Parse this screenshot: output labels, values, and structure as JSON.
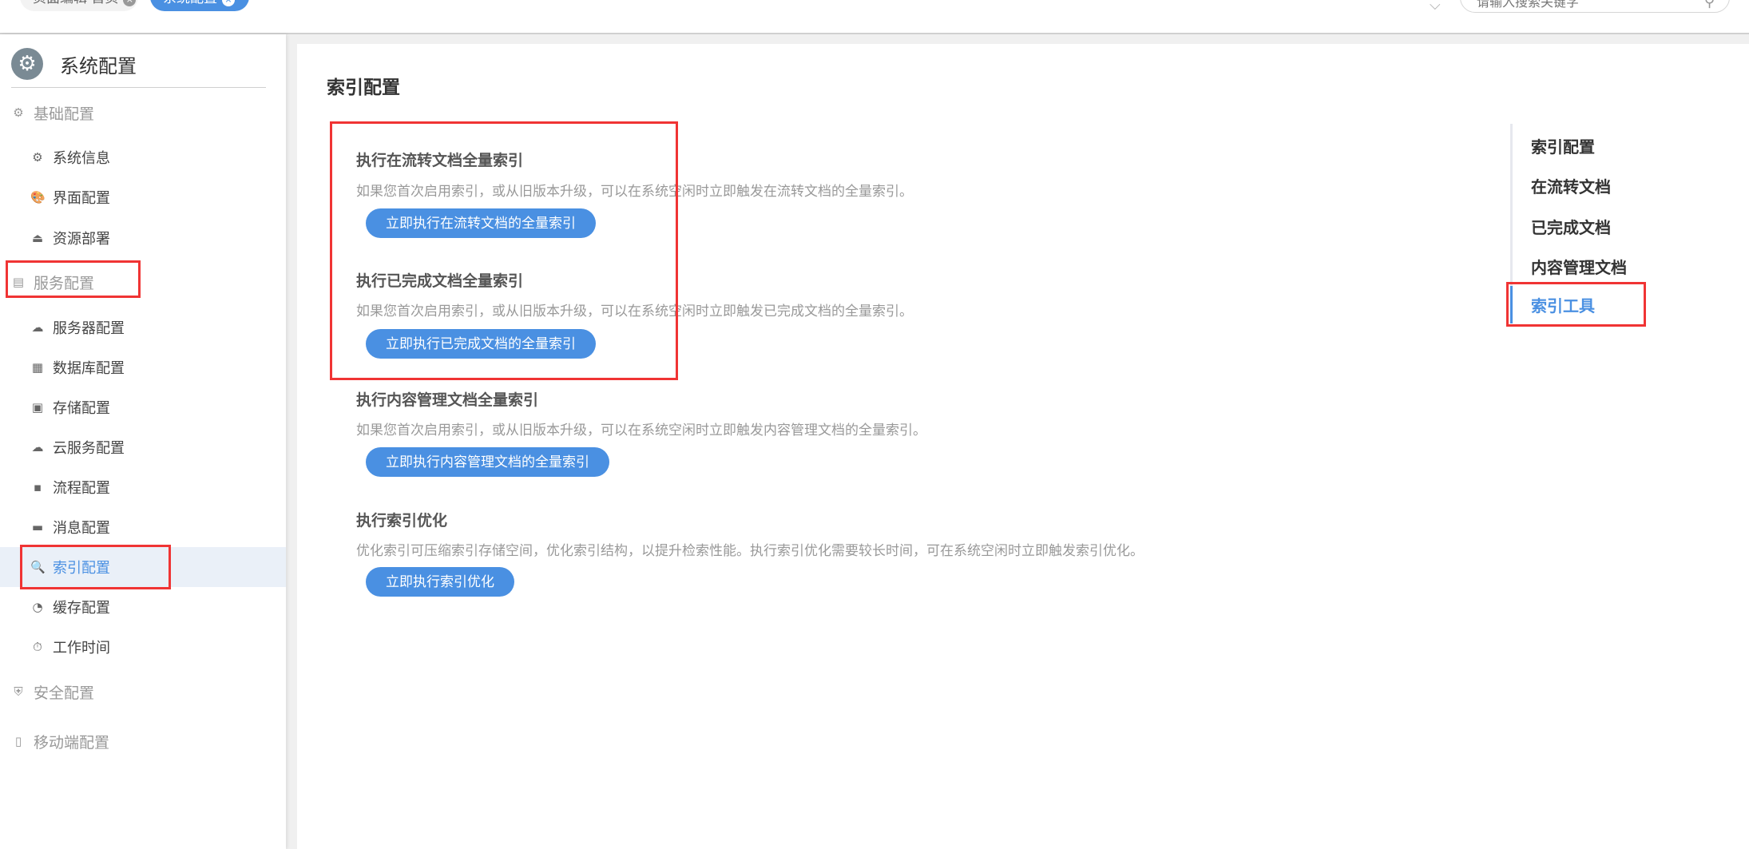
{
  "topbar": {
    "tabs": [
      {
        "label": "页面编辑 首页",
        "close": "×"
      },
      {
        "label": "系统配置",
        "close": "×"
      }
    ],
    "search_placeholder": "请输入搜索关键字",
    "dropdown_icon": "chevron-down-icon",
    "search_icon": "search-icon"
  },
  "sidebar": {
    "title": "系统配置",
    "items": [
      {
        "label": "基础配置",
        "type": "group",
        "icon": "⚙"
      },
      {
        "label": "系统信息",
        "type": "child",
        "icon": "⚙"
      },
      {
        "label": "界面配置",
        "type": "child",
        "icon": "🎨"
      },
      {
        "label": "资源部署",
        "type": "child",
        "icon": "⏏"
      },
      {
        "label": "服务配置",
        "type": "group",
        "icon": "▤"
      },
      {
        "label": "服务器配置",
        "type": "child",
        "icon": "☁"
      },
      {
        "label": "数据库配置",
        "type": "child",
        "icon": "▦"
      },
      {
        "label": "存储配置",
        "type": "child",
        "icon": "▣"
      },
      {
        "label": "云服务配置",
        "type": "child",
        "icon": "☁"
      },
      {
        "label": "流程配置",
        "type": "child",
        "icon": "▪"
      },
      {
        "label": "消息配置",
        "type": "child",
        "icon": "▬"
      },
      {
        "label": "索引配置",
        "type": "child",
        "icon": "🔍",
        "selected": true
      },
      {
        "label": "缓存配置",
        "type": "child",
        "icon": "◔"
      },
      {
        "label": "工作时间",
        "type": "child",
        "icon": "⏱"
      },
      {
        "label": "安全配置",
        "type": "group",
        "icon": "⛨"
      },
      {
        "label": "移动端配置",
        "type": "group",
        "icon": "▯"
      }
    ]
  },
  "main": {
    "title": "索引配置",
    "sections": [
      {
        "heading": "执行在流转文档全量索引",
        "desc": "如果您首次启用索引，或从旧版本升级，可以在系统空闲时立即触发在流转文档的全量索引。",
        "button": "立即执行在流转文档的全量索引"
      },
      {
        "heading": "执行已完成文档全量索引",
        "desc": "如果您首次启用索引，或从旧版本升级，可以在系统空闲时立即触发已完成文档的全量索引。",
        "button": "立即执行已完成文档的全量索引"
      },
      {
        "heading": "执行内容管理文档全量索引",
        "desc": "如果您首次启用索引，或从旧版本升级，可以在系统空闲时立即触发内容管理文档的全量索引。",
        "button": "立即执行内容管理文档的全量索引"
      },
      {
        "heading": "执行索引优化",
        "desc": "优化索引可压缩索引存储空间，优化索引结构，以提升检索性能。执行索引优化需要较长时间，可在系统空闲时立即触发索引优化。",
        "button": "立即执行索引优化"
      }
    ]
  },
  "toc": {
    "items": [
      "索引配置",
      "在流转文档",
      "已完成文档",
      "内容管理文档",
      "索引工具"
    ],
    "active": "索引工具"
  },
  "colors": {
    "accent": "#4a90e2",
    "annotation": "#f03434"
  }
}
